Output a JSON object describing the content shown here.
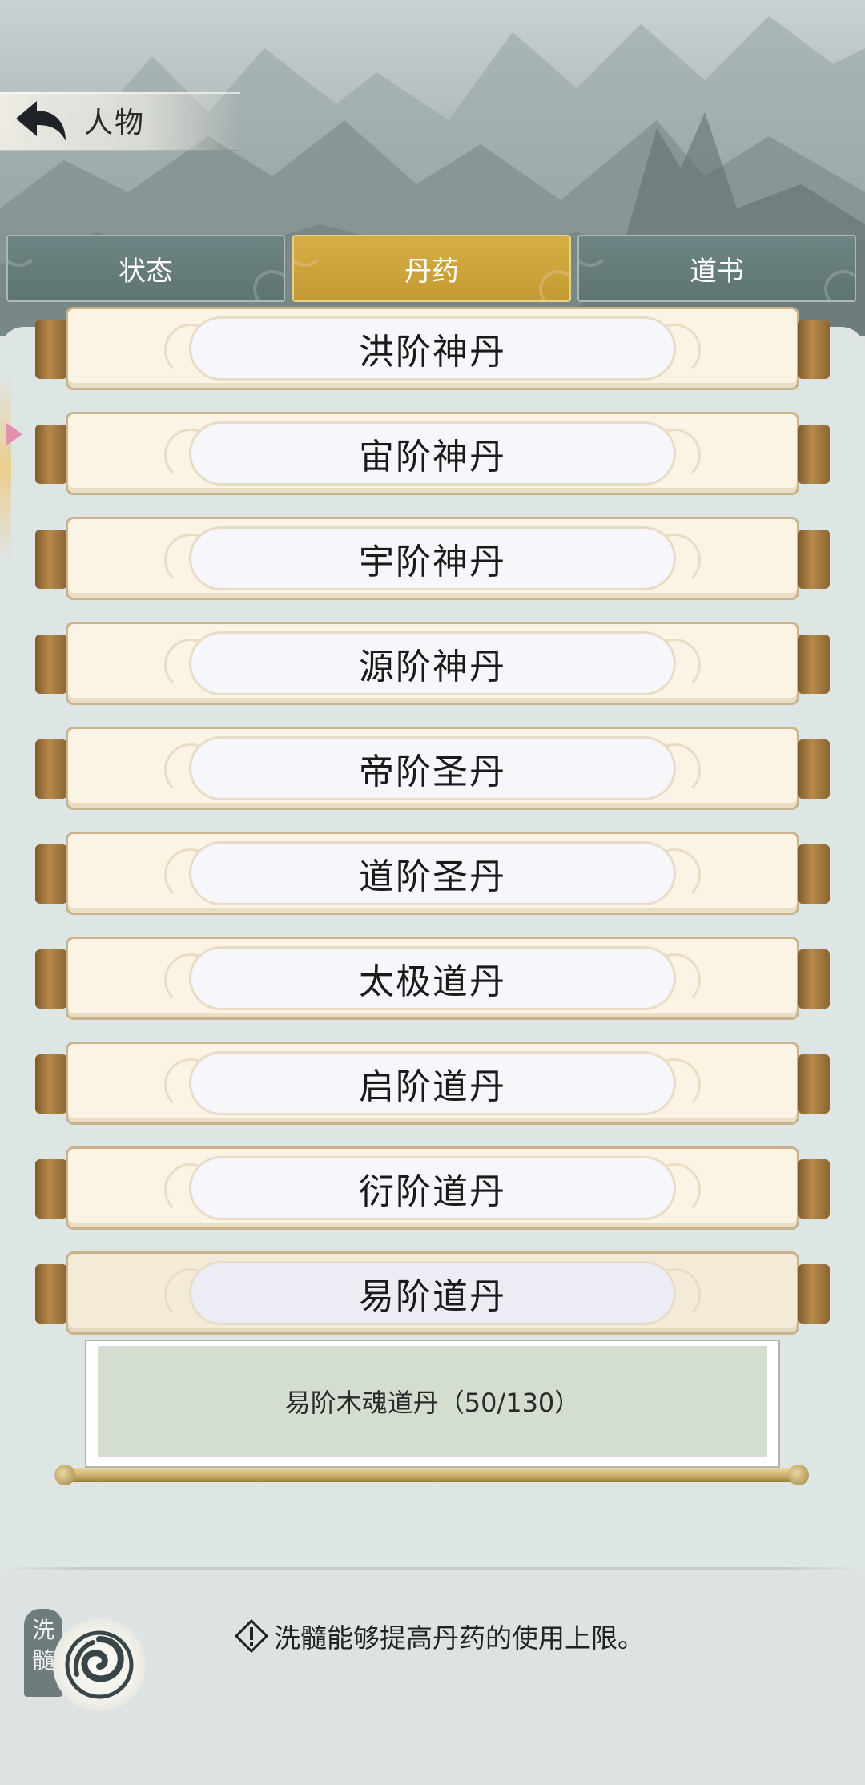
{
  "header": {
    "title": "人物"
  },
  "tabs": [
    {
      "label": "状态",
      "active": false
    },
    {
      "label": "丹药",
      "active": true
    },
    {
      "label": "道书",
      "active": false
    }
  ],
  "pills": [
    {
      "label": "洪阶神丹"
    },
    {
      "label": "宙阶神丹"
    },
    {
      "label": "宇阶神丹"
    },
    {
      "label": "源阶神丹"
    },
    {
      "label": "帝阶圣丹"
    },
    {
      "label": "道阶圣丹"
    },
    {
      "label": "太极道丹"
    },
    {
      "label": "启阶道丹"
    },
    {
      "label": "衍阶道丹"
    },
    {
      "label": "易阶道丹",
      "selected": true
    }
  ],
  "detail": {
    "text": "易阶木魂道丹（50/130）"
  },
  "footer": {
    "badge_chars": [
      "洗",
      "髓"
    ],
    "hint": "洗髓能够提高丹药的使用上限。"
  },
  "colors": {
    "active_tab": "#c9a03a",
    "inactive_tab": "#667c7b",
    "panel_bg": "#dee5e5",
    "paper": "#fbf4e4",
    "detail_bg": "#d3ddd0"
  },
  "icons": {
    "back": "back-arrow-icon",
    "warning": "warning-icon",
    "wash": "swirl-icon"
  }
}
